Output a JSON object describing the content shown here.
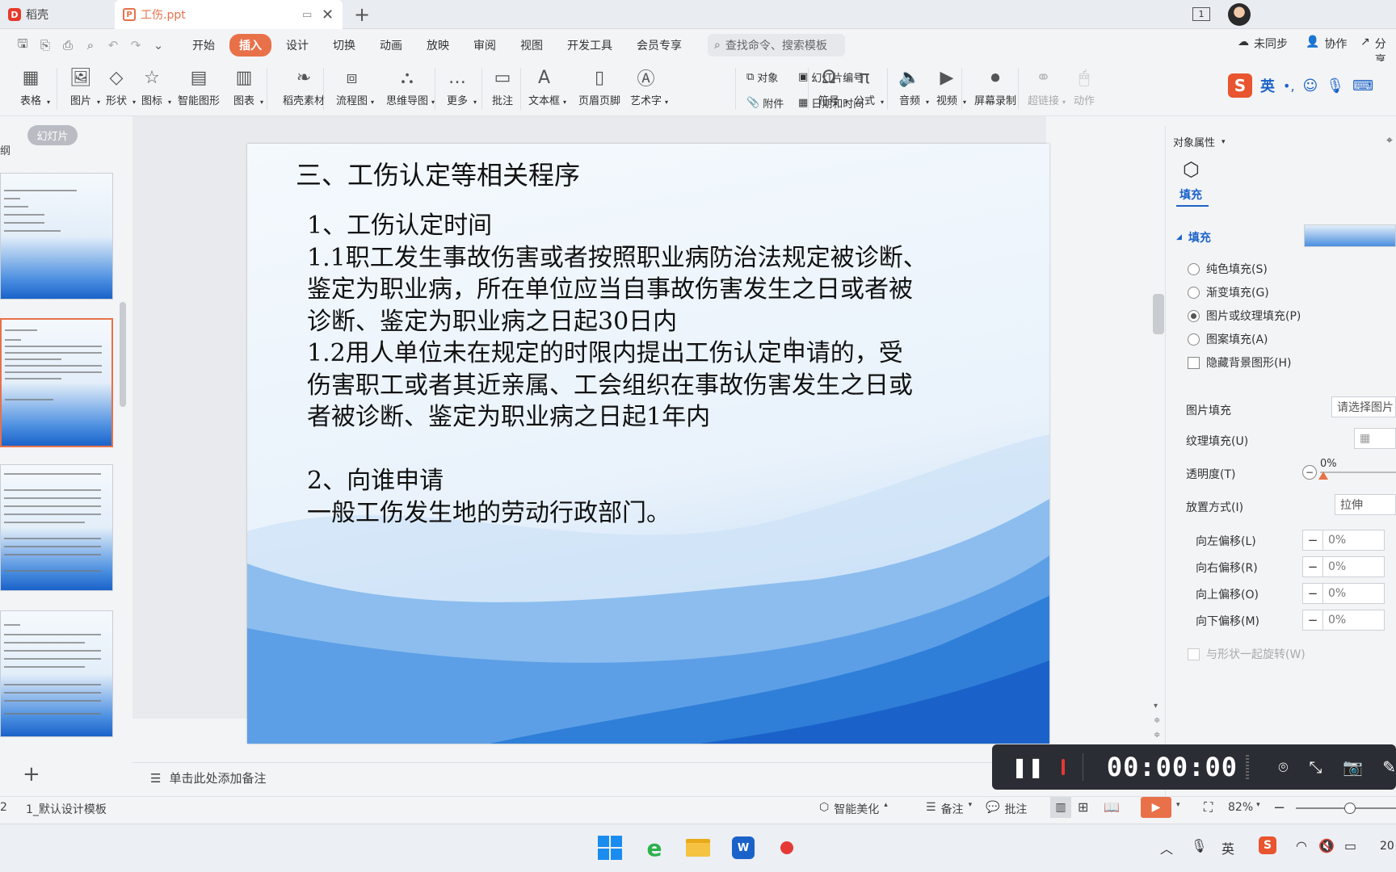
{
  "titlebar": {
    "app_tab": "稻壳",
    "doc_tab": "工伤.ppt",
    "window_num": "1"
  },
  "menu": {
    "items": [
      "开始",
      "插入",
      "设计",
      "切换",
      "动画",
      "放映",
      "审阅",
      "视图",
      "开发工具",
      "会员专享"
    ],
    "active_index": 1,
    "search_placeholder": "查找命令、搜索模板",
    "right": {
      "sync": "未同步",
      "collab": "协作",
      "share": "分享"
    }
  },
  "ribbon": {
    "items": [
      {
        "label": "表格",
        "icon": "table-icon"
      },
      {
        "label": "图片",
        "icon": "picture-icon"
      },
      {
        "label": "形状",
        "icon": "shape-icon"
      },
      {
        "label": "图标",
        "icon": "icons-icon"
      },
      {
        "label": "智能图形",
        "icon": "smartart-icon"
      },
      {
        "label": "图表",
        "icon": "chart-icon"
      },
      {
        "label": "稻壳素材",
        "icon": "material-icon"
      },
      {
        "label": "流程图",
        "icon": "flowchart-icon"
      },
      {
        "label": "思维导图",
        "icon": "mindmap-icon"
      },
      {
        "label": "更多",
        "icon": "more-icon"
      },
      {
        "label": "批注",
        "icon": "comment-icon"
      },
      {
        "label": "文本框",
        "icon": "textbox-icon"
      },
      {
        "label": "页眉页脚",
        "icon": "header-footer-icon"
      },
      {
        "label": "艺术字",
        "icon": "wordart-icon"
      }
    ],
    "small": {
      "object": "对象",
      "slide_number": "幻灯片编号",
      "attachment": "附件",
      "datetime": "日期和时间"
    },
    "items2": [
      {
        "label": "符号",
        "icon": "symbol-icon"
      },
      {
        "label": "公式",
        "icon": "formula-icon"
      },
      {
        "label": "音频",
        "icon": "audio-icon"
      },
      {
        "label": "视频",
        "icon": "video-icon"
      },
      {
        "label": "屏幕录制",
        "icon": "screen-record-icon"
      },
      {
        "label": "超链接",
        "icon": "hyperlink-icon"
      },
      {
        "label": "动作",
        "icon": "action-icon"
      }
    ],
    "ime": {
      "lang": "英"
    }
  },
  "left_pane": {
    "outline_label": "纲",
    "slides_label": "幻灯片"
  },
  "slide": {
    "title": "三、工伤认定等相关程序",
    "lines": [
      "1、工伤认定时间",
      "1.1职工发生事故伤害或者按照职业病防治法规定被诊断、",
      "鉴定为职业病，所在单位应当自事故伤害发生之日或者被",
      "诊断、鉴定为职业病之日起30日内",
      "1.2用人单位未在规定的时限内提出工伤认定申请的，受",
      "伤害职工或者其近亲属、工会组织在事故伤害发生之日或",
      "者被诊断、鉴定为职业病之日起1年内",
      "",
      "2、向谁申请",
      "一般工伤发生地的劳动行政部门。"
    ]
  },
  "notes": {
    "placeholder": "单击此处添加备注"
  },
  "props": {
    "header": "对象属性",
    "tab": "填充",
    "section": "填充",
    "options": [
      {
        "label": "纯色填充(S)",
        "type": "radio",
        "on": false
      },
      {
        "label": "渐变填充(G)",
        "type": "radio",
        "on": false
      },
      {
        "label": "图片或纹理填充(P)",
        "type": "radio",
        "on": true
      },
      {
        "label": "图案填充(A)",
        "type": "radio",
        "on": false
      },
      {
        "label": "隐藏背景图形(H)",
        "type": "check",
        "on": false
      }
    ],
    "picture_fill_label": "图片填充",
    "picture_fill_value": "请选择图片",
    "texture_label": "纹理填充(U)",
    "transparency_label": "透明度(T)",
    "transparency_value": "0%",
    "placement_label": "放置方式(I)",
    "placement_value": "拉伸",
    "offsets": [
      {
        "label": "向左偏移(L)",
        "value": "0%"
      },
      {
        "label": "向右偏移(R)",
        "value": "0%"
      },
      {
        "label": "向上偏移(O)",
        "value": "0%"
      },
      {
        "label": "向下偏移(M)",
        "value": "0%"
      }
    ],
    "rotate_with_shape": "与形状一起旋转(W)"
  },
  "recorder": {
    "time": "00:00:00"
  },
  "status": {
    "slide_num": "2",
    "template": "1_默认设计模板",
    "beautify": "智能美化",
    "notes": "备注",
    "comments": "批注",
    "zoom": "82%"
  },
  "taskbar": {
    "ime": "英",
    "clock": "20"
  },
  "colors": {
    "accent": "#e8714a",
    "slide_blue": "#1a62c9"
  }
}
